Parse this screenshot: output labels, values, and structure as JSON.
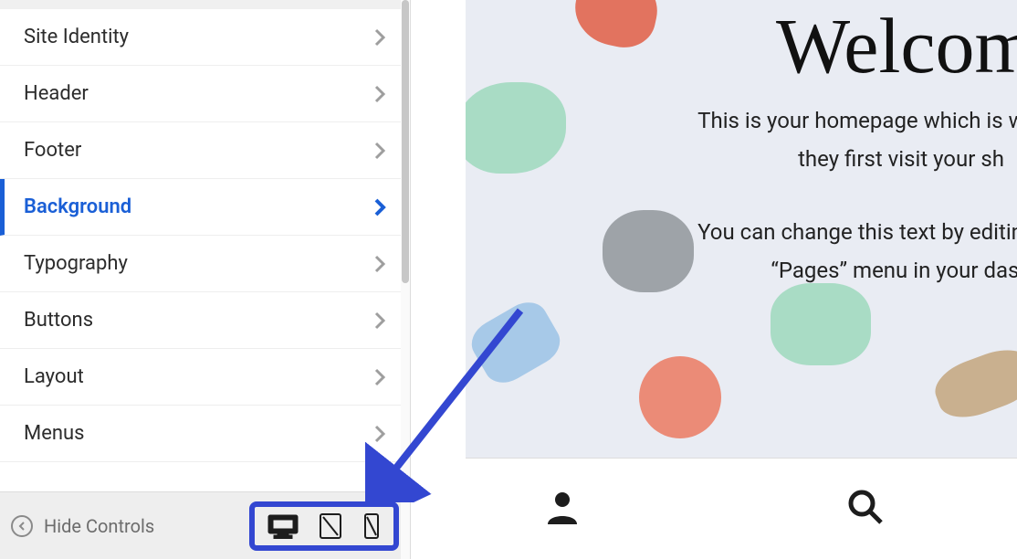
{
  "sidebar": {
    "items": [
      {
        "label": "Site Identity",
        "active": false
      },
      {
        "label": "Header",
        "active": false
      },
      {
        "label": "Footer",
        "active": false
      },
      {
        "label": "Background",
        "active": true
      },
      {
        "label": "Typography",
        "active": false
      },
      {
        "label": "Buttons",
        "active": false
      },
      {
        "label": "Layout",
        "active": false
      },
      {
        "label": "Menus",
        "active": false
      }
    ],
    "hide_controls_label": "Hide Controls"
  },
  "preview": {
    "title": "Welcom",
    "line1": "This is your homepage which is what mos",
    "line2": "they first visit your sh",
    "line3": "You can change this text by editing the “W",
    "line4": "“Pages” menu in your dash"
  }
}
